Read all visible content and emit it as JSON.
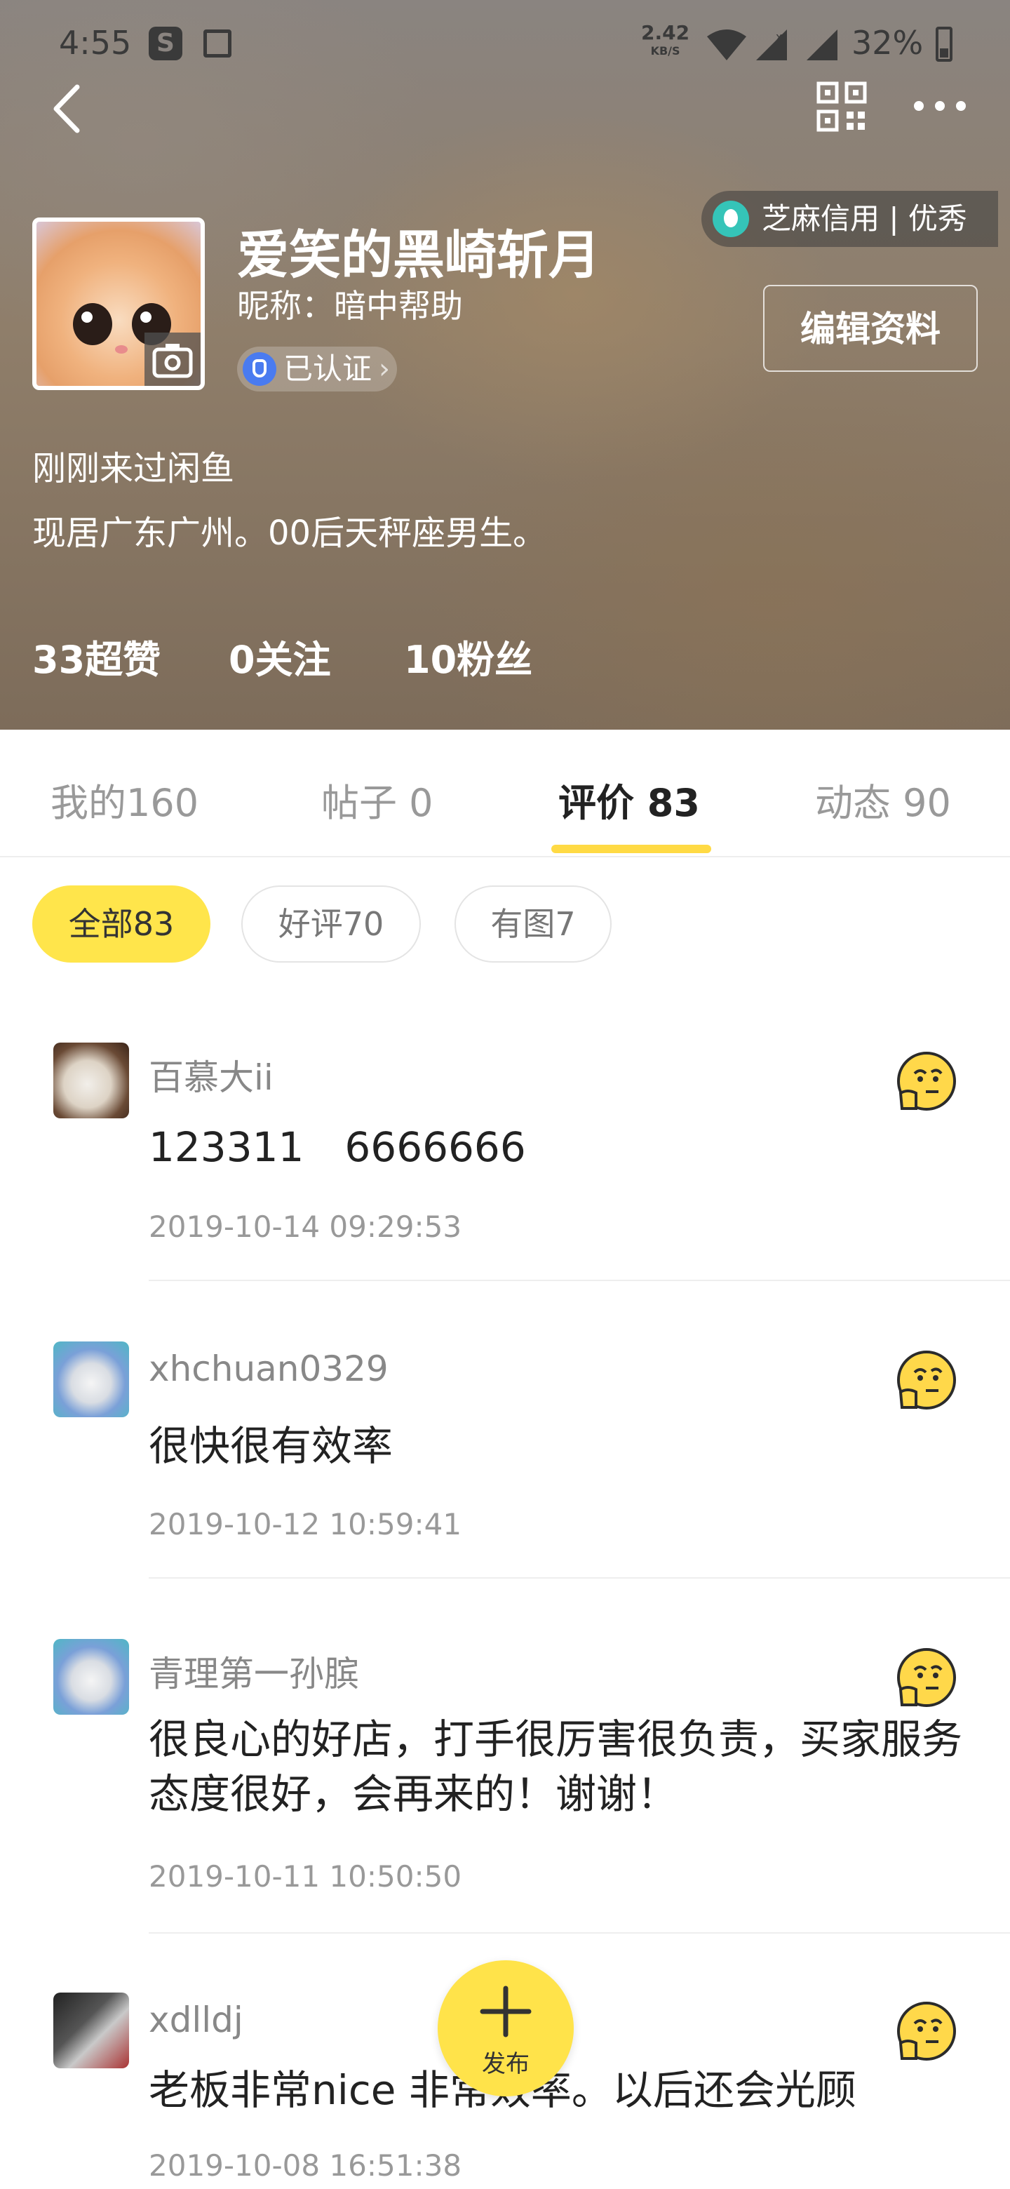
{
  "status_bar": {
    "time": "4:55",
    "speed_value": "2.42",
    "speed_unit": "KB/S",
    "battery": "32%"
  },
  "profile": {
    "nickname": "爱笑的黑崎斩月",
    "alias": "昵称：暗中帮助",
    "verified": "已认证",
    "credit_badge": "芝麻信用 | 优秀",
    "edit_label": "编辑资料",
    "bio_line1": "刚刚来过闲鱼",
    "bio_line2": "现居广东广州。00后天秤座男生。",
    "stats": {
      "likes": "33超赞",
      "following": "0关注",
      "followers": "10粉丝"
    }
  },
  "tabs": [
    {
      "label": "我的160"
    },
    {
      "label": "帖子 0"
    },
    {
      "label": "评价 83"
    },
    {
      "label": "动态 90"
    }
  ],
  "filters": [
    {
      "label": "全部83"
    },
    {
      "label": "好评70"
    },
    {
      "label": "有图7"
    }
  ],
  "reviews": [
    {
      "name": "百慕大ii",
      "text": "123311　6666666",
      "time": "2019-10-14 09:29:53"
    },
    {
      "name": "xhchuan0329",
      "text": "很快很有效率",
      "time": "2019-10-12 10:59:41"
    },
    {
      "name": "青理第一孙膑",
      "text": "很良心的好店，打手很厉害很负责，买家服务态度很好，会再来的！谢谢！",
      "time": "2019-10-11 10:50:50"
    },
    {
      "name": "xdlldj",
      "text": "老板非常nice 非常效率。以后还会光顾",
      "time": "2019-10-08 16:51:38"
    }
  ],
  "fab": {
    "label": "发布"
  },
  "colors": {
    "accent": "#ffda44",
    "chip_active": "#ffe54b"
  }
}
